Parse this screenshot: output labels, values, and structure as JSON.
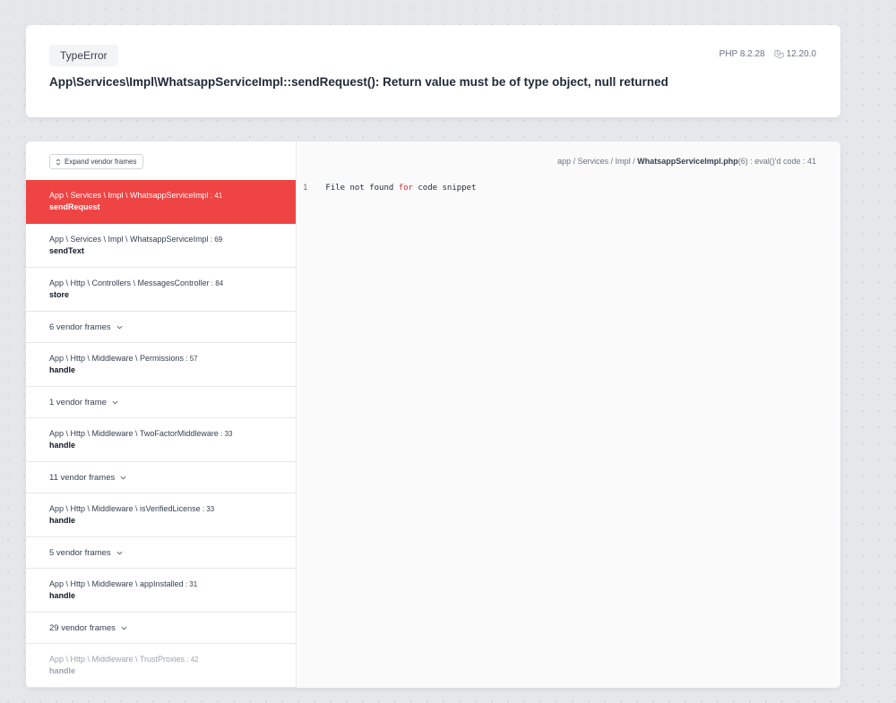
{
  "header": {
    "exception_type": "TypeError",
    "php_version": "PHP 8.2.28",
    "laravel_version": "12.20.0",
    "laravel_icon": "laravel-logo-icon",
    "message": "App\\Services\\Impl\\WhatsappServiceImpl::sendRequest(): Return value must be of type object, null returned"
  },
  "stack": {
    "expand_button_label": "Expand vendor frames",
    "items": [
      {
        "kind": "frame",
        "class": "App \\ Services \\ Impl \\ WhatsappServiceImpl",
        "line": "41",
        "method": "sendRequest",
        "state": "active"
      },
      {
        "kind": "frame",
        "class": "App \\ Services \\ Impl \\ WhatsappServiceImpl",
        "line": "69",
        "method": "sendText",
        "state": ""
      },
      {
        "kind": "frame",
        "class": "App \\ Http \\ Controllers \\ MessagesController",
        "line": "84",
        "method": "store",
        "state": ""
      },
      {
        "kind": "vendor",
        "label": "6 vendor frames"
      },
      {
        "kind": "frame",
        "class": "App \\ Http \\ Middleware \\ Permissions",
        "line": "57",
        "method": "handle",
        "state": ""
      },
      {
        "kind": "vendor",
        "label": "1 vendor frame"
      },
      {
        "kind": "frame",
        "class": "App \\ Http \\ Middleware \\ TwoFactorMiddleware",
        "line": "33",
        "method": "handle",
        "state": ""
      },
      {
        "kind": "vendor",
        "label": "11 vendor frames"
      },
      {
        "kind": "frame",
        "class": "App \\ Http \\ Middleware \\ isVerifiedLicense",
        "line": "33",
        "method": "handle",
        "state": ""
      },
      {
        "kind": "vendor",
        "label": "5 vendor frames"
      },
      {
        "kind": "frame",
        "class": "App \\ Http \\ Middleware \\ appInstalled",
        "line": "31",
        "method": "handle",
        "state": ""
      },
      {
        "kind": "vendor",
        "label": "29 vendor frames"
      },
      {
        "kind": "frame",
        "class": "App \\ Http \\ Middleware \\ TrustProxies",
        "line": "42",
        "method": "handle",
        "state": "faded"
      }
    ]
  },
  "code": {
    "path_prefix": "app / Services / Impl / ",
    "path_file": "WhatsappServiceImpl.php",
    "path_suffix": "(6) : eval()'d code : 41",
    "line_number": "1",
    "code_before": "File not found ",
    "code_keyword": "for",
    "code_after": " code snippet"
  },
  "colors": {
    "active_frame": "#ef4444",
    "keyword": "#dc2626"
  }
}
